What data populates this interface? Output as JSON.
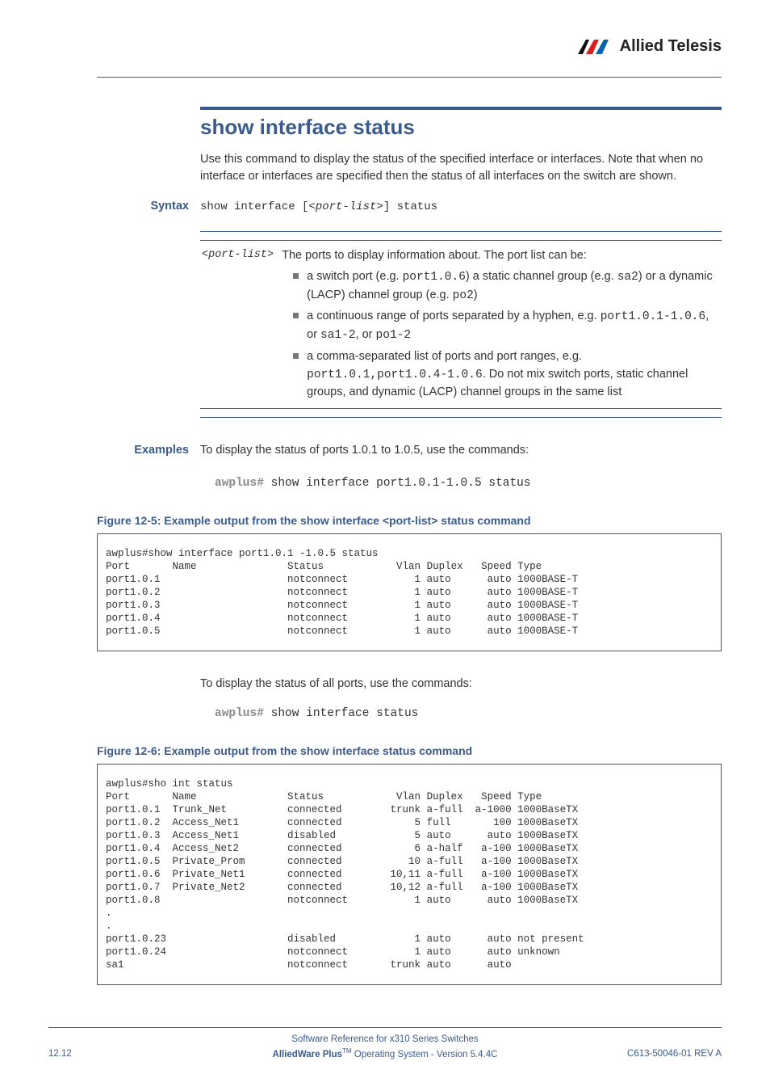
{
  "brand": "Allied Telesis",
  "title": "show interface status",
  "intro": "Use this command to display the status of the specified interface or interfaces. Note that when no interface or interfaces are specified then the status of all interfaces on the switch are shown.",
  "syntax_label": "Syntax",
  "syntax_cmd_pre": "show interface [",
  "syntax_cmd_param": "<port-list>",
  "syntax_cmd_post": "] status",
  "param_key": "<port-list>",
  "param_lead": "The ports to display information about. The port list can be:",
  "param_b1_a": "a switch port (e.g. ",
  "param_b1_code1": "port1.0.6",
  "param_b1_b": ") a static channel group (e.g. ",
  "param_b1_code2": "sa2",
  "param_b1_c": ") or a dynamic (LACP) channel group (e.g. ",
  "param_b1_code3": "po2",
  "param_b1_d": ")",
  "param_b2_a": "a continuous range of ports separated by a hyphen, e.g. ",
  "param_b2_code1": "port1.0.1-1.0.6",
  "param_b2_b": ", or ",
  "param_b2_code2": "sa1-2",
  "param_b2_c": ", or ",
  "param_b2_code3": "po1-2",
  "param_b3_a": "a comma-separated list of ports and port ranges, e.g. ",
  "param_b3_code1": "port1.0.1,port1.0.4-1.0.6",
  "param_b3_b": ". Do not mix switch ports, static channel groups, and dynamic (LACP) channel groups in the same list",
  "examples_label": "Examples",
  "example1_text": "To display the status of ports 1.0.1 to 1.0.5, use the commands:",
  "example1_prompt": "awplus#",
  "example1_cmd": " show interface port1.0.1-1.0.5 status",
  "fig5_caption": "Figure 12-5: Example output from the show interface <port-list> status command",
  "fig5_output": "awplus#show interface port1.0.1 -1.0.5 status\nPort       Name               Status            Vlan Duplex   Speed Type\nport1.0.1                     notconnect           1 auto      auto 1000BASE-T\nport1.0.2                     notconnect           1 auto      auto 1000BASE-T\nport1.0.3                     notconnect           1 auto      auto 1000BASE-T\nport1.0.4                     notconnect           1 auto      auto 1000BASE-T\nport1.0.5                     notconnect           1 auto      auto 1000BASE-T\n",
  "example2_text": "To display the status of all ports, use the commands:",
  "example2_prompt": "awplus#",
  "example2_cmd": " show interface status",
  "fig6_caption": "Figure 12-6: Example output from the show interface status command",
  "fig6_output": "awplus#sho int status\nPort       Name               Status            Vlan Duplex   Speed Type\nport1.0.1  Trunk_Net          connected        trunk a-full  a-1000 1000BaseTX\nport1.0.2  Access_Net1        connected            5 full       100 1000BaseTX\nport1.0.3  Access_Net1        disabled             5 auto      auto 1000BaseTX\nport1.0.4  Access_Net2        connected            6 a-half   a-100 1000BaseTX\nport1.0.5  Private_Prom       connected           10 a-full   a-100 1000BaseTX\nport1.0.6  Private_Net1       connected        10,11 a-full   a-100 1000BaseTX\nport1.0.7  Private_Net2       connected        10,12 a-full   a-100 1000BaseTX\nport1.0.8                     notconnect           1 auto      auto 1000BaseTX\n.\n.\nport1.0.23                    disabled             1 auto      auto not present\nport1.0.24                    notconnect           1 auto      auto unknown\nsa1                           notconnect       trunk auto      auto\n",
  "footer_line1": "Software Reference for x310 Series Switches",
  "footer_product": "AlliedWare Plus",
  "footer_tm": "TM",
  "footer_line2_rest": " Operating System  - Version 5.4.4C",
  "footer_left": "12.12",
  "footer_right": "C613-50046-01 REV A"
}
